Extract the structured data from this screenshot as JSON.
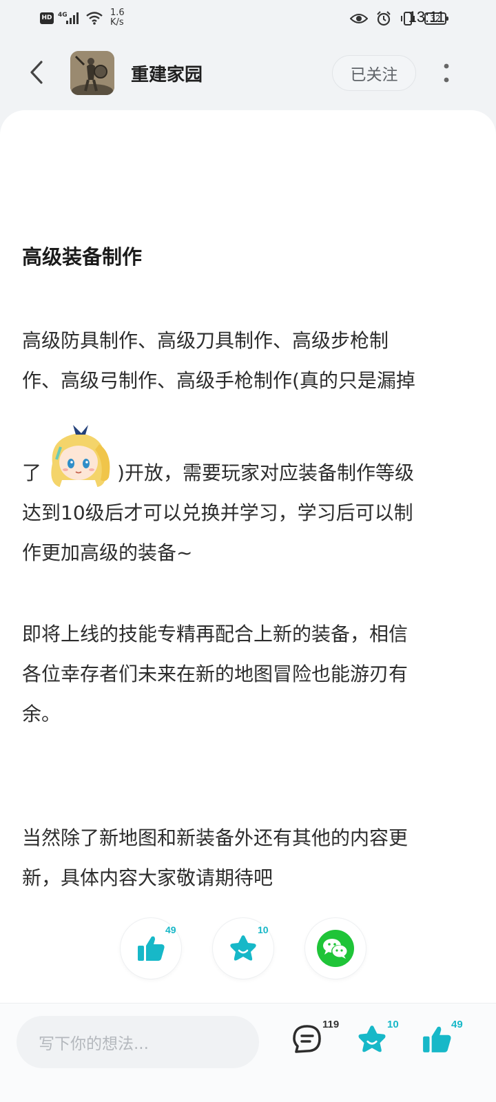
{
  "status_bar": {
    "hd_label": "HD",
    "network_label": "4G",
    "speed_value": "1.6",
    "speed_unit": "K/s",
    "battery": "32",
    "time": "13:11"
  },
  "header": {
    "title": "重建家园",
    "follow_label": "已关注",
    "back_icon": "chevron-left-icon",
    "more_icon": "more-vertical-icon"
  },
  "article": {
    "heading": "高级装备制作",
    "para1_lines": [
      "高级防具制作、高级刀具制作、高级步枪制",
      "作、高级弓制作、高级手枪制作(真的只是漏掉"
    ],
    "para1_line3_prefix": "了",
    "para1_line3_suffix": ")开放，需要玩家对应装备制作等级",
    "para1_lines_rest": [
      "达到10级后才可以兑换并学习，学习后可以制",
      "作更加高级的装备~"
    ],
    "para2_lines": [
      "即将上线的技能专精再配合上新的装备，相信",
      "各位幸存者们未来在新的地图冒险也能游刃有",
      "余。"
    ],
    "para3_lines": [
      "当然除了新地图和新装备外还有其他的内容更",
      "新，具体内容大家敬请期待吧"
    ]
  },
  "reactions": {
    "like_count": "49",
    "favorite_count": "10"
  },
  "bottom_bar": {
    "comment_placeholder": "写下你的想法...",
    "comment_count": "119",
    "favorite_count": "10",
    "like_count": "49"
  },
  "colors": {
    "accent_teal": "#16b7c7",
    "wechat_green": "#1fc438"
  }
}
